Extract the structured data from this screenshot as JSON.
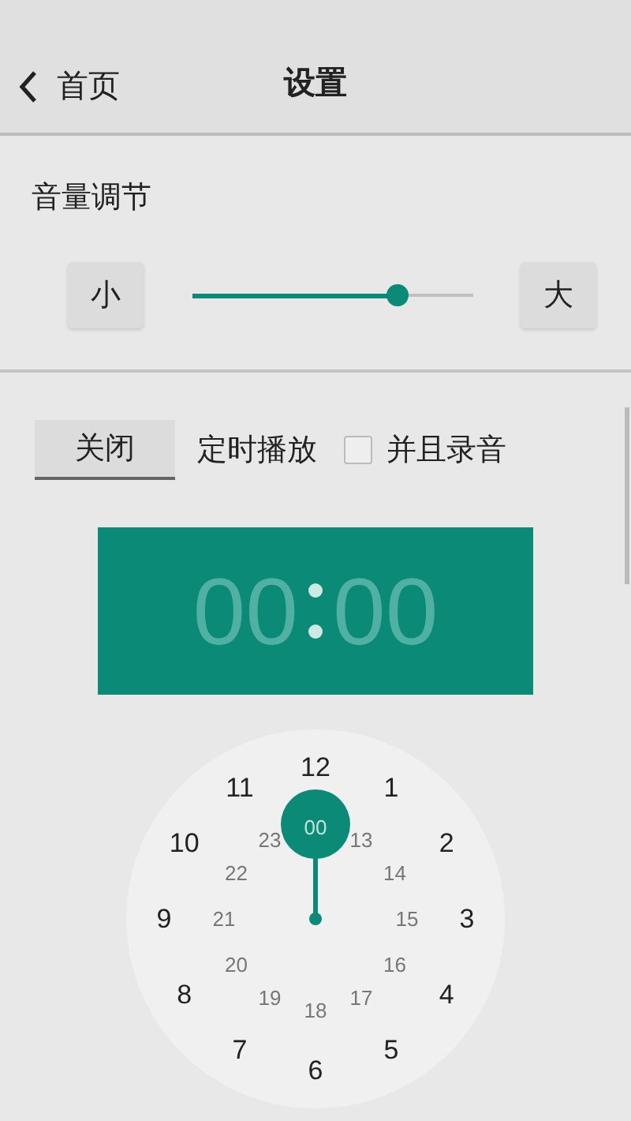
{
  "header": {
    "back_label": "首页",
    "title": "设置"
  },
  "volume": {
    "label": "音量调节",
    "min_button": "小",
    "max_button": "大",
    "level": 0.73
  },
  "timer": {
    "toggle_button": "关闭",
    "label": "定时播放",
    "record": {
      "label": "并且录音",
      "checked": false
    }
  },
  "time_display": {
    "hours": "00",
    "minutes": "00"
  },
  "dial": {
    "outer": [
      "12",
      "1",
      "2",
      "3",
      "4",
      "5",
      "6",
      "7",
      "8",
      "9",
      "10",
      "11"
    ],
    "inner": [
      {
        "label": "00",
        "selected": true
      },
      {
        "label": "13",
        "selected": false
      },
      {
        "label": "14",
        "selected": false
      },
      {
        "label": "15",
        "selected": false
      },
      {
        "label": "16",
        "selected": false
      },
      {
        "label": "17",
        "selected": false
      },
      {
        "label": "18",
        "selected": false
      },
      {
        "label": "19",
        "selected": false
      },
      {
        "label": "20",
        "selected": false
      },
      {
        "label": "21",
        "selected": false
      },
      {
        "label": "22",
        "selected": false
      },
      {
        "label": "23",
        "selected": false
      }
    ]
  }
}
